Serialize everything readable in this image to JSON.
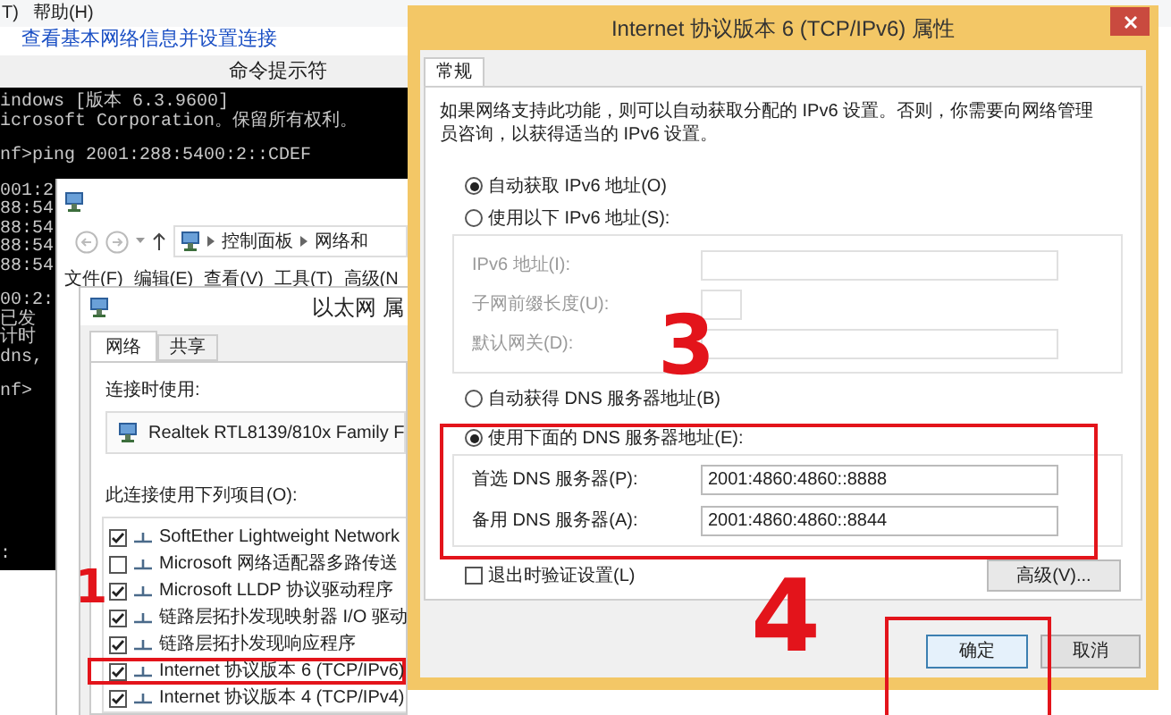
{
  "menu_bar": {
    "items": [
      "T)",
      "帮助(H)"
    ]
  },
  "link": "查看基本网络信息并设置连接",
  "command_prompt": {
    "title": "命令提示符",
    "blocks": [
      [
        "indows [版本 6.3.9600]",
        "icrosoft Corporation。保留所有权利。"
      ],
      [
        "nf>ping 2001:288:5400:2::CDEF"
      ],
      [
        "001:2",
        "88:54",
        "88:54",
        "88:54",
        "88:54"
      ],
      [
        "00:2:",
        "已发",
        "计时",
        "dns,"
      ],
      [
        "nf>"
      ],
      [
        ":"
      ]
    ]
  },
  "explorer": {
    "breadcrumb": [
      "控制面板",
      "网络和"
    ],
    "menu": [
      "文件(F)",
      "编辑(E)",
      "查看(V)",
      "工具(T)",
      "高级(N"
    ]
  },
  "ethernet_properties": {
    "title": "以太网 属",
    "tabs": [
      {
        "label": "网络",
        "selected": true
      },
      {
        "label": "共享",
        "selected": false
      }
    ],
    "connect_using_label": "连接时使用:",
    "adapter": "Realtek RTL8139/810x Family F",
    "items_label": "此连接使用下列项目(O):",
    "items": [
      {
        "label": "SoftEther Lightweight Network",
        "checked": true
      },
      {
        "label": "Microsoft 网络适配器多路传送",
        "checked": false
      },
      {
        "label": "Microsoft LLDP 协议驱动程序",
        "checked": true
      },
      {
        "label": "链路层拓扑发现映射器 I/O 驱动",
        "checked": true
      },
      {
        "label": "链路层拓扑发现响应程序",
        "checked": true
      },
      {
        "label": "Internet 协议版本 6 (TCP/IPv6)",
        "checked": true,
        "highlighted": true
      },
      {
        "label": "Internet 协议版本 4 (TCP/IPv4)",
        "checked": true
      }
    ]
  },
  "ipv6_dialog": {
    "title": "Internet 协议版本 6 (TCP/IPv6) 属性",
    "tabs": [
      {
        "label": "常规",
        "selected": true
      }
    ],
    "description": "如果网络支持此功能，则可以自动获取分配的 IPv6 设置。否则，你需要向网络管理员咨询，以获得适当的 IPv6 设置。",
    "address_options": [
      {
        "label": "自动获取 IPv6 地址(O)",
        "selected": true
      },
      {
        "label": "使用以下 IPv6 地址(S):",
        "selected": false
      }
    ],
    "address_fields": [
      {
        "label": "IPv6 地址(I):",
        "kind": "wide",
        "disabled": true
      },
      {
        "label": "子网前缀长度(U):",
        "kind": "narrow",
        "disabled": true
      },
      {
        "label": "默认网关(D):",
        "kind": "wide",
        "disabled": true
      }
    ],
    "dns_options": [
      {
        "label": "自动获得 DNS 服务器地址(B)",
        "selected": false
      },
      {
        "label": "使用下面的 DNS 服务器地址(E):",
        "selected": true
      }
    ],
    "dns_fields": [
      {
        "label": "首选 DNS 服务器(P):",
        "value": "2001:4860:4860::8888"
      },
      {
        "label": "备用 DNS 服务器(A):",
        "value": "2001:4860:4860::8844"
      }
    ],
    "validate_on_exit": {
      "label": "退出时验证设置(L)",
      "checked": false
    },
    "advanced_button": "高级(V)...",
    "buttons": [
      {
        "label": "确定",
        "default": true
      },
      {
        "label": "取消",
        "default": false
      }
    ]
  },
  "annotations": [
    "1",
    "3",
    "4"
  ]
}
